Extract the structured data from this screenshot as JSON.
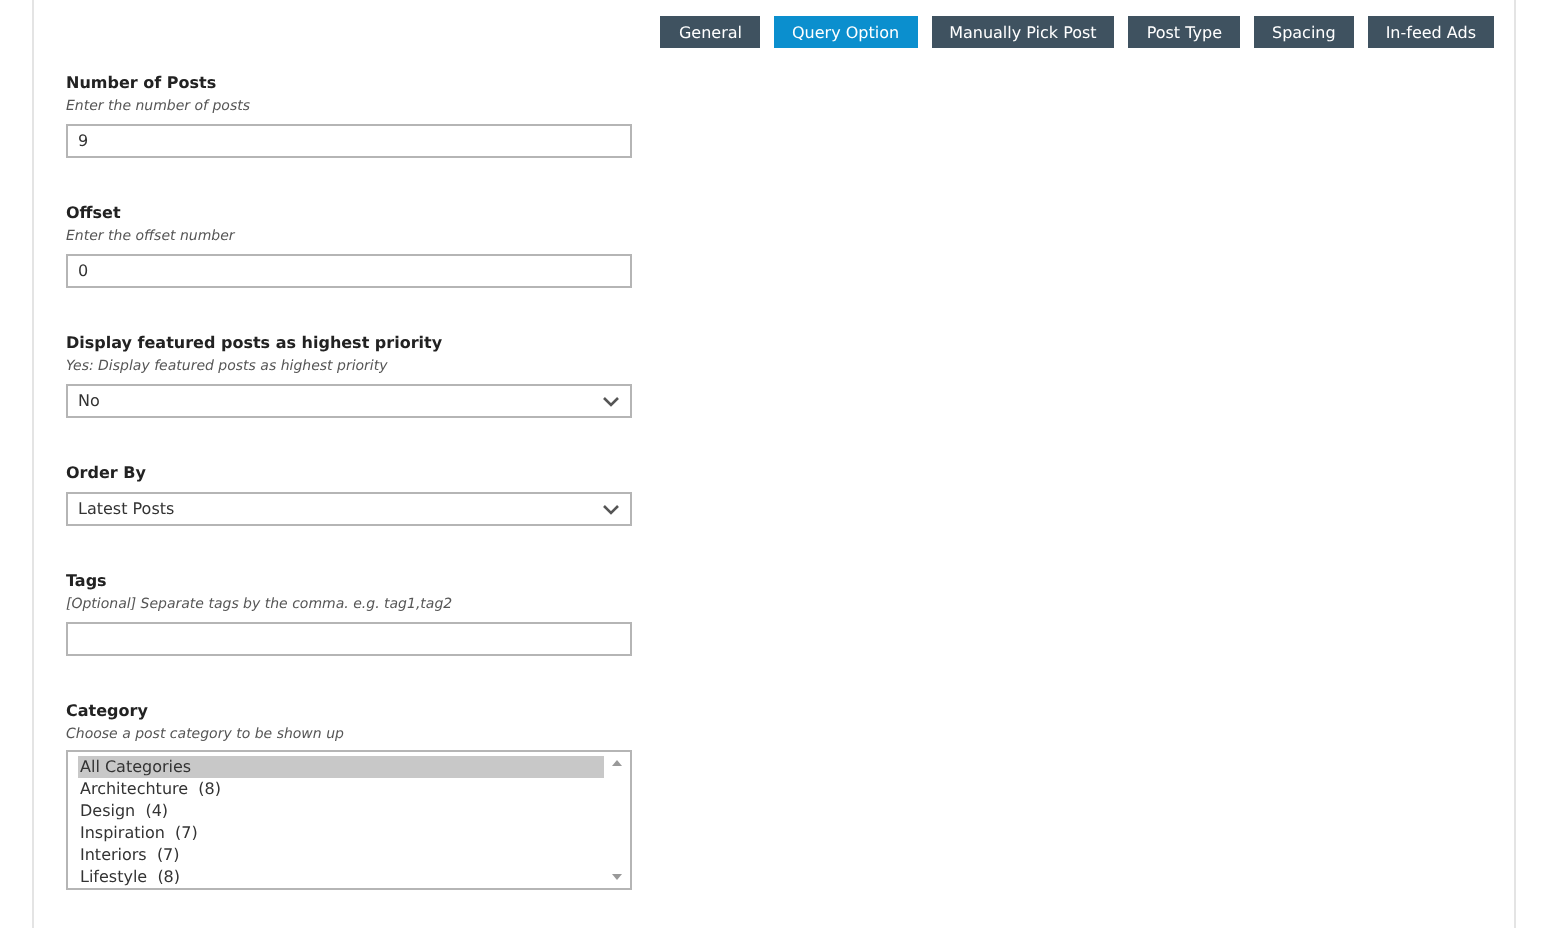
{
  "tabs": [
    {
      "label": "General",
      "selected": false
    },
    {
      "label": "Query Option",
      "selected": true
    },
    {
      "label": "Manually Pick Post",
      "selected": false
    },
    {
      "label": "Post Type",
      "selected": false
    },
    {
      "label": "Spacing",
      "selected": false
    },
    {
      "label": "In-feed Ads",
      "selected": false
    }
  ],
  "fields": [
    {
      "kind": "input",
      "label": "Number of Posts",
      "hint": "Enter the number of posts",
      "value": "9"
    },
    {
      "kind": "input",
      "label": "Offset",
      "hint": "Enter the offset number",
      "value": "0"
    },
    {
      "kind": "select",
      "label": "Display featured posts as highest priority",
      "hint": "Yes: Display featured posts as highest priority",
      "value": "No"
    },
    {
      "kind": "select",
      "label": "Order By",
      "value": "Latest Posts"
    },
    {
      "kind": "input",
      "label": "Tags",
      "hint": "[Optional] Separate tags by the comma. e.g. tag1,tag2"
    },
    {
      "kind": "listbox",
      "label": "Category",
      "hint": "Choose a post category to be shown up",
      "options": [
        {
          "label": "All Categories",
          "selected": true
        },
        {
          "label": "Architechture  (8)",
          "selected": false
        },
        {
          "label": "Design  (4)",
          "selected": false
        },
        {
          "label": "Inspiration  (7)",
          "selected": false
        },
        {
          "label": "Interiors  (7)",
          "selected": false
        },
        {
          "label": "Lifestyle  (8)",
          "selected": false
        }
      ]
    }
  ]
}
